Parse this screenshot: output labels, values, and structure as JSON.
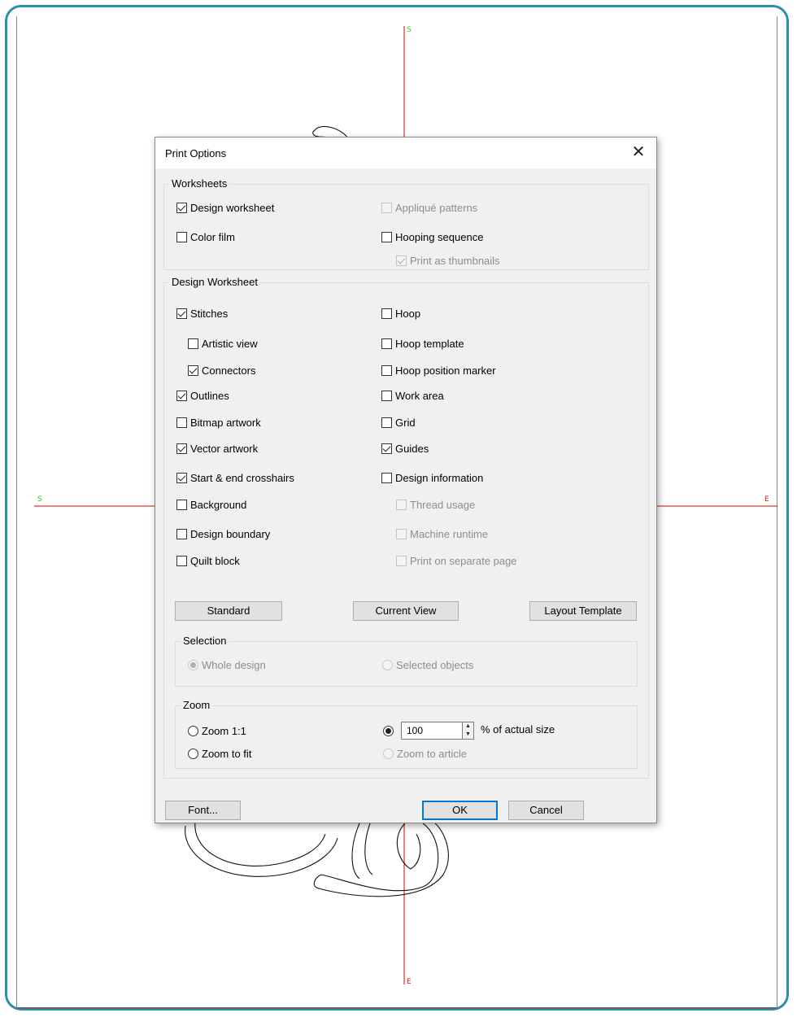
{
  "canvas": {
    "marker_top": "S",
    "marker_bottom": "E",
    "marker_left": "S",
    "marker_right": "E",
    "colors": {
      "frame": "#2b8fb0",
      "crosshair": "#dd0000",
      "start_marker": "#2ecc2e"
    }
  },
  "dialog": {
    "title": "Print Options",
    "close_icon": "close-icon",
    "worksheets": {
      "title": "Worksheets",
      "design_worksheet": "Design worksheet",
      "applique_patterns": "Appliqué patterns",
      "color_film": "Color film",
      "hooping_sequence": "Hooping sequence",
      "print_as_thumbnails": "Print as thumbnails"
    },
    "design_worksheet": {
      "title": "Design Worksheet",
      "stitches": "Stitches",
      "artistic_view": "Artistic view",
      "connectors": "Connectors",
      "outlines": "Outlines",
      "bitmap_artwork": "Bitmap artwork",
      "vector_artwork": "Vector artwork",
      "start_end_crosshairs": "Start & end crosshairs",
      "background": "Background",
      "design_boundary": "Design boundary",
      "quilt_block": "Quilt block",
      "hoop": "Hoop",
      "hoop_template": "Hoop template",
      "hoop_position_marker": "Hoop position marker",
      "work_area": "Work area",
      "grid": "Grid",
      "guides": "Guides",
      "design_information": "Design information",
      "thread_usage": "Thread usage",
      "machine_runtime": "Machine runtime",
      "print_on_separate_page": "Print on separate page",
      "standard_button": "Standard",
      "current_view_button": "Current View",
      "layout_template_button": "Layout Template",
      "selection": {
        "title": "Selection",
        "whole_design": "Whole design",
        "selected_objects": "Selected objects"
      },
      "zoom": {
        "title": "Zoom",
        "zoom_1_1": "Zoom 1:1",
        "zoom_to_fit": "Zoom to fit",
        "percent_value": "100",
        "percent_label": "% of actual size",
        "zoom_to_article": "Zoom to article"
      }
    },
    "font_button": "Font...",
    "ok_button": "OK",
    "cancel_button": "Cancel"
  }
}
